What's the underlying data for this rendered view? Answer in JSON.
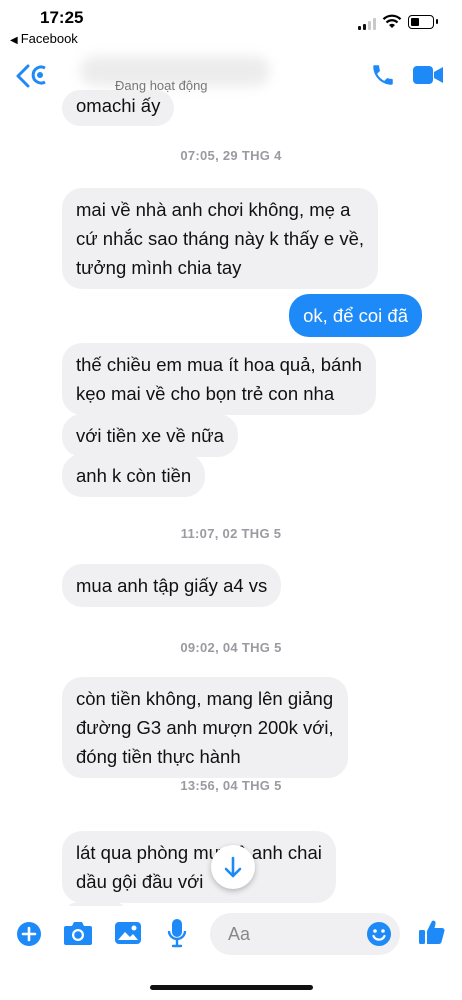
{
  "status_bar": {
    "time": "17:25",
    "back_app": "Facebook"
  },
  "header": {
    "contact_status": "Đang hoạt động"
  },
  "messages": [
    {
      "kind": "in",
      "text": "omachi ấy"
    },
    {
      "kind": "timestamp",
      "text": "07:05, 29 THG 4"
    },
    {
      "kind": "in",
      "text": "mai về nhà anh chơi không, mẹ a\ncứ nhắc sao tháng này k thấy e về,\ntưởng mình chia tay"
    },
    {
      "kind": "out",
      "text": "ok, để coi đã"
    },
    {
      "kind": "in",
      "text": "thế chiều em mua ít hoa quả, bánh\nkẹo mai về cho bọn trẻ con nha"
    },
    {
      "kind": "in",
      "text": "với tiền xe về nữa"
    },
    {
      "kind": "in",
      "text": "anh k còn tiền"
    },
    {
      "kind": "timestamp",
      "text": "11:07, 02 THG 5"
    },
    {
      "kind": "in",
      "text": "mua anh tập giấy a4 vs"
    },
    {
      "kind": "timestamp",
      "text": "09:02, 04 THG 5"
    },
    {
      "kind": "in",
      "text": "còn tiền không, mang lên giảng\nđường G3 anh mượn 200k với,\nđóng tiền thực hành"
    },
    {
      "kind": "timestamp",
      "text": "13:56, 04 THG 5"
    },
    {
      "kind": "in",
      "text": "lát qua phòng mư  hộ anh chai\ndầu gội đầu với"
    }
  ],
  "composer": {
    "placeholder": "Aa"
  },
  "icons": {
    "back": "chevron-left-icon",
    "call": "phone-icon",
    "video": "video-camera-icon",
    "plus": "plus-circle-icon",
    "camera": "camera-icon",
    "gallery": "image-icon",
    "mic": "microphone-icon",
    "emoji": "smiley-icon",
    "like": "thumbs-up-icon",
    "scroll": "arrow-down-icon"
  },
  "colors": {
    "accent": "#1d8af7",
    "incoming_bubble": "#f0f0f2",
    "timestamp": "#9a9aa0"
  }
}
